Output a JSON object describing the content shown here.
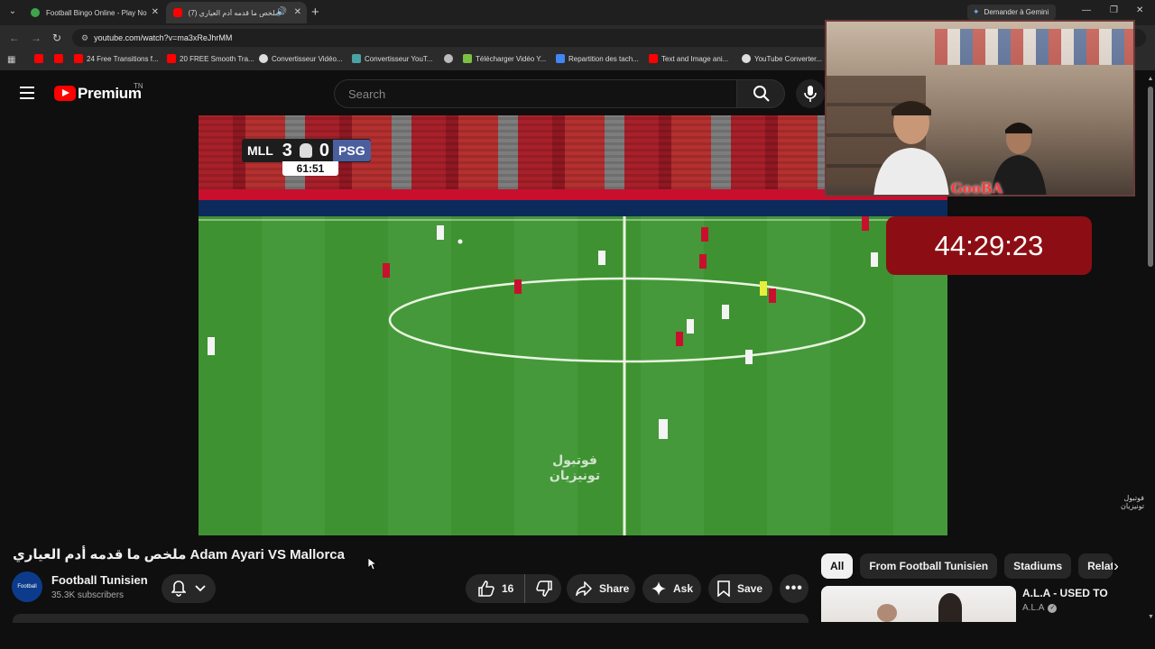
{
  "browser": {
    "tabs": [
      {
        "title": "Football Bingo Online - Play No",
        "favicon_color": "#3fa34d"
      },
      {
        "title": "ملخص ما قدمه أدم العياري (7)",
        "favicon_color": "#ff0000"
      }
    ],
    "gemini_label": "Demander à Gemini",
    "url": "youtube.com/watch?v=ma3xReJhrMM",
    "bookmarks": [
      {
        "label": "",
        "icon_color": "#ff0000"
      },
      {
        "label": "",
        "icon_color": "#ff0000"
      },
      {
        "label": "24 Free Transitions f...",
        "icon_color": "#ff0000"
      },
      {
        "label": "20 FREE Smooth Tra...",
        "icon_color": "#ff0000"
      },
      {
        "label": "Convertisseur Vidéo...",
        "icon_color": "#dddddd"
      },
      {
        "label": "Convertisseur YouT...",
        "icon_color": "#4aa3a2"
      },
      {
        "label": "",
        "icon_color": "#bbbbbb"
      },
      {
        "label": "Télécharger Vidéo Y...",
        "icon_color": "#7cc043"
      },
      {
        "label": "Repartition des tach...",
        "icon_color": "#4285f4"
      },
      {
        "label": "Text and Image ani...",
        "icon_color": "#ff0000"
      },
      {
        "label": "YouTube Converter...",
        "icon_color": "#dddddd"
      }
    ]
  },
  "youtube": {
    "logo_text": "Premium",
    "region": "TN",
    "search_placeholder": "Search"
  },
  "video": {
    "scorebug": {
      "home": "MLL",
      "home_score": "3",
      "away_score": "0",
      "away": "PSG",
      "clock": "61:51"
    },
    "watermark": "فوتبول تونيزيان"
  },
  "overlay": {
    "streamer_name": "GooBA",
    "timer": "44:29:23"
  },
  "watch": {
    "title": "ملخص ما قدمه أدم العياري Adam Ayari VS Mallorca",
    "channel_name": "Football Tunisien",
    "subscribers": "35.3K subscribers",
    "likes": "16",
    "share_label": "Share",
    "ask_label": "Ask",
    "save_label": "Save"
  },
  "related": {
    "chips": [
      "All",
      "From Football Tunisien",
      "Stadiums",
      "Relate"
    ],
    "first": {
      "title": "A.L.A - USED TO",
      "channel": "A.L.A"
    }
  },
  "colors": {
    "brand_red": "#ff0000",
    "timer_bg": "#8c0e14",
    "background": "#0f0f0f"
  }
}
